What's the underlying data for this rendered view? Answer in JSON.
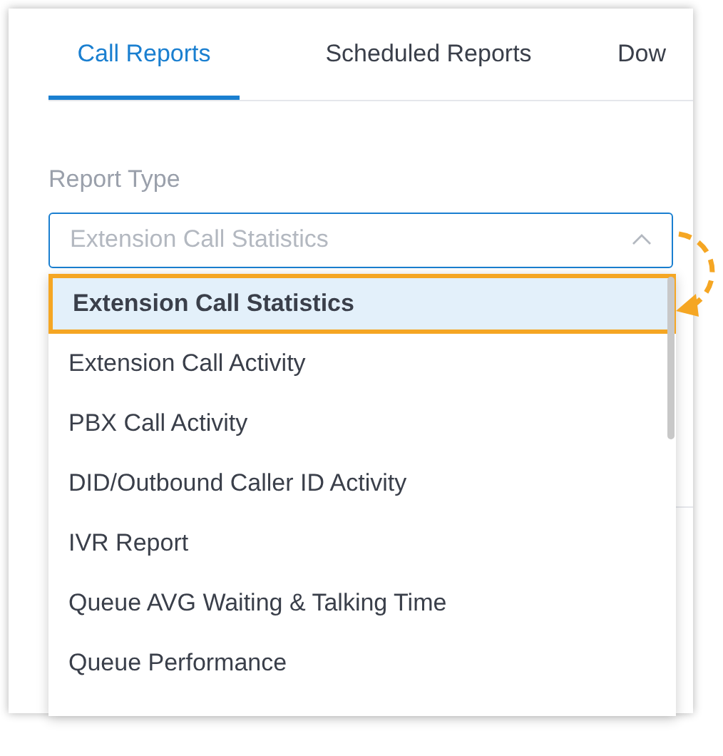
{
  "tabs": [
    {
      "label": "Call Reports",
      "selected": true
    },
    {
      "label": "Scheduled Reports",
      "selected": false
    },
    {
      "label": "Dow",
      "selected": false
    }
  ],
  "report_type": {
    "label": "Report Type",
    "placeholder": "Extension Call Statistics",
    "expanded": true
  },
  "options": [
    {
      "label": "Extension Call Statistics",
      "selected": true,
      "annotated": true
    },
    {
      "label": "Extension Call Activity",
      "selected": false,
      "annotated": false
    },
    {
      "label": "PBX Call Activity",
      "selected": false,
      "annotated": false
    },
    {
      "label": "DID/Outbound Caller ID Activity",
      "selected": false,
      "annotated": false
    },
    {
      "label": "IVR Report",
      "selected": false,
      "annotated": false
    },
    {
      "label": "Queue AVG Waiting & Talking Time",
      "selected": false,
      "annotated": false
    },
    {
      "label": "Queue Performance",
      "selected": false,
      "annotated": false
    }
  ]
}
